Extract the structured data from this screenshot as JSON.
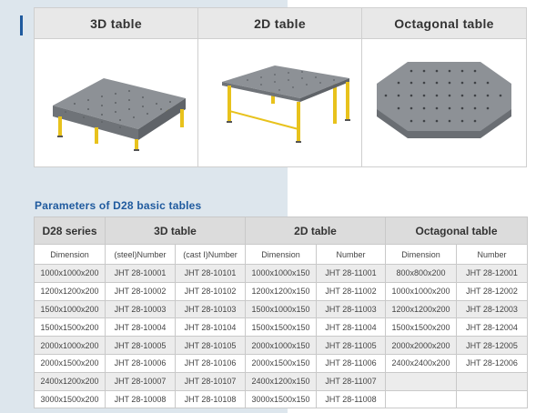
{
  "products": [
    {
      "title": "3D table",
      "icon": "3d-welding-table-image"
    },
    {
      "title": "2D table",
      "icon": "2d-welding-table-image"
    },
    {
      "title": "Octagonal table",
      "icon": "octagonal-table-image"
    }
  ],
  "params": {
    "title": "Parameters of D28 basic tables",
    "groups": {
      "series": "D28 series",
      "t3d": "3D table",
      "t2d": "2D table",
      "oct": "Octagonal table"
    },
    "subheaders": [
      "Dimension",
      "(steel)Number",
      "(cast I)Number",
      "Dimension",
      "Number",
      "Dimension",
      "Number"
    ],
    "rows": [
      [
        "1000x1000x200",
        "JHT 28-10001",
        "JHT 28-10101",
        "1000x1000x150",
        "JHT 28-11001",
        "800x800x200",
        "JHT 28-12001"
      ],
      [
        "1200x1200x200",
        "JHT 28-10002",
        "JHT 28-10102",
        "1200x1200x150",
        "JHT 28-11002",
        "1000x1000x200",
        "JHT 28-12002"
      ],
      [
        "1500x1000x200",
        "JHT 28-10003",
        "JHT 28-10103",
        "1500x1000x150",
        "JHT 28-11003",
        "1200x1200x200",
        "JHT 28-12003"
      ],
      [
        "1500x1500x200",
        "JHT 28-10004",
        "JHT 28-10104",
        "1500x1500x150",
        "JHT 28-11004",
        "1500x1500x200",
        "JHT 28-12004"
      ],
      [
        "2000x1000x200",
        "JHT 28-10005",
        "JHT 28-10105",
        "2000x1000x150",
        "JHT 28-11005",
        "2000x2000x200",
        "JHT 28-12005"
      ],
      [
        "2000x1500x200",
        "JHT 28-10006",
        "JHT 28-10106",
        "2000x1500x150",
        "JHT 28-11006",
        "2400x2400x200",
        "JHT 28-12006"
      ],
      [
        "2400x1200x200",
        "JHT 28-10007",
        "JHT 28-10107",
        "2400x1200x150",
        "JHT 28-11007",
        "",
        ""
      ],
      [
        "3000x1500x200",
        "JHT 28-10008",
        "JHT 28-10108",
        "3000x1500x150",
        "JHT 28-11008",
        "",
        ""
      ]
    ]
  },
  "colors": {
    "accent": "#1f5a9e",
    "panel": "#dde6ed",
    "leg_yellow": "#e8c21c",
    "table_steel": "#8d9196"
  }
}
